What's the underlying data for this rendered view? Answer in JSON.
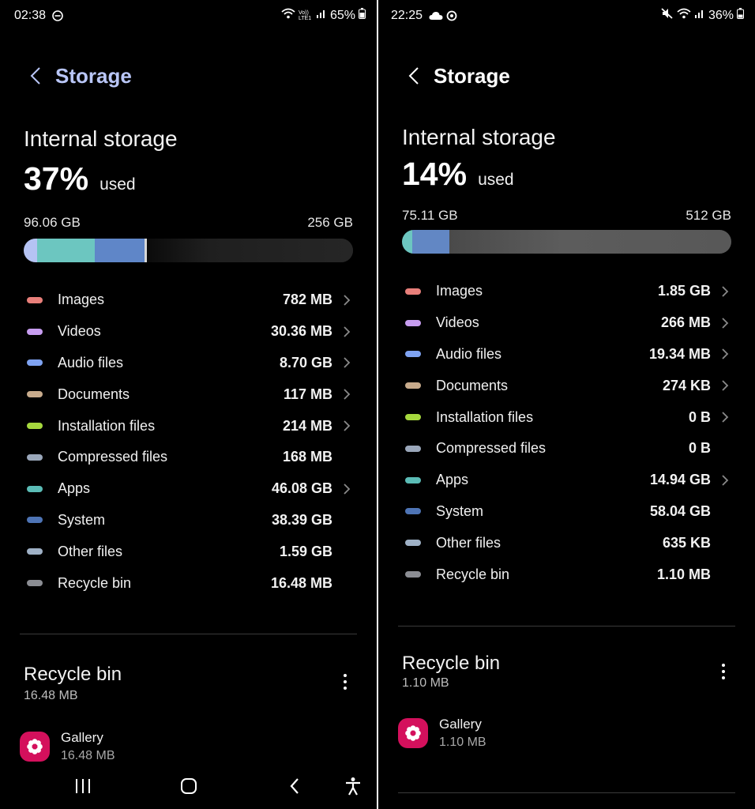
{
  "left": {
    "status": {
      "time": "02:38",
      "battery": "65%",
      "volte": "Vo)) LTE1"
    },
    "header": {
      "title": "Storage"
    },
    "storage": {
      "title": "Internal storage",
      "percent": "37%",
      "used_label": "used",
      "used_amount": "96.06 GB",
      "total": "256 GB",
      "used_fraction": 0.37
    },
    "categories": [
      {
        "label": "Images",
        "size": "782 MB",
        "color": "#e87f7a",
        "chevron": true
      },
      {
        "label": "Videos",
        "size": "30.36 MB",
        "color": "#c79df0",
        "chevron": true
      },
      {
        "label": "Audio files",
        "size": "8.70 GB",
        "color": "#7fa3f2",
        "chevron": true
      },
      {
        "label": "Documents",
        "size": "117 MB",
        "color": "#c8ab8c",
        "chevron": true
      },
      {
        "label": "Installation files",
        "size": "214 MB",
        "color": "#a6d83e",
        "chevron": true
      },
      {
        "label": "Compressed files",
        "size": "168 MB",
        "color": "#9aa7ba",
        "chevron": false
      },
      {
        "label": "Apps",
        "size": "46.08 GB",
        "color": "#5bbcb6",
        "chevron": true
      },
      {
        "label": "System",
        "size": "38.39 GB",
        "color": "#4e74b5",
        "chevron": false
      },
      {
        "label": "Other files",
        "size": "1.59 GB",
        "color": "#9fb1c6",
        "chevron": false
      },
      {
        "label": "Recycle bin",
        "size": "16.48 MB",
        "color": "#8b8d93",
        "chevron": false
      }
    ],
    "recycle_bin": {
      "title": "Recycle bin",
      "size": "16.48 MB"
    },
    "apps": [
      {
        "name": "Gallery",
        "size": "16.48 MB"
      }
    ]
  },
  "right": {
    "status": {
      "time": "22:25",
      "battery": "36%"
    },
    "header": {
      "title": "Storage"
    },
    "storage": {
      "title": "Internal storage",
      "percent": "14%",
      "used_label": "used",
      "used_amount": "75.11 GB",
      "total": "512 GB",
      "used_fraction": 0.14
    },
    "categories": [
      {
        "label": "Images",
        "size": "1.85 GB",
        "color": "#e87f7a",
        "chevron": true
      },
      {
        "label": "Videos",
        "size": "266 MB",
        "color": "#c79df0",
        "chevron": true
      },
      {
        "label": "Audio files",
        "size": "19.34 MB",
        "color": "#7fa3f2",
        "chevron": true
      },
      {
        "label": "Documents",
        "size": "274 KB",
        "color": "#c8ab8c",
        "chevron": true
      },
      {
        "label": "Installation files",
        "size": "0 B",
        "color": "#a6d83e",
        "chevron": true
      },
      {
        "label": "Compressed files",
        "size": "0 B",
        "color": "#9aa7ba",
        "chevron": false
      },
      {
        "label": "Apps",
        "size": "14.94 GB",
        "color": "#5bbcb6",
        "chevron": true
      },
      {
        "label": "System",
        "size": "58.04 GB",
        "color": "#4e74b5",
        "chevron": false
      },
      {
        "label": "Other files",
        "size": "635 KB",
        "color": "#9fb1c6",
        "chevron": false
      },
      {
        "label": "Recycle bin",
        "size": "1.10 MB",
        "color": "#8b8d93",
        "chevron": false
      }
    ],
    "recycle_bin": {
      "title": "Recycle bin",
      "size": "1.10 MB"
    },
    "apps": [
      {
        "name": "Gallery",
        "size": "1.10 MB"
      }
    ]
  },
  "colors": {
    "background": "#000000",
    "accent_title": "#b9c6f7",
    "gallery_icon": "#d4105c"
  },
  "icons": {
    "left_nav": [
      "recents-icon",
      "home-icon",
      "back-icon",
      "accessibility-icon"
    ]
  }
}
